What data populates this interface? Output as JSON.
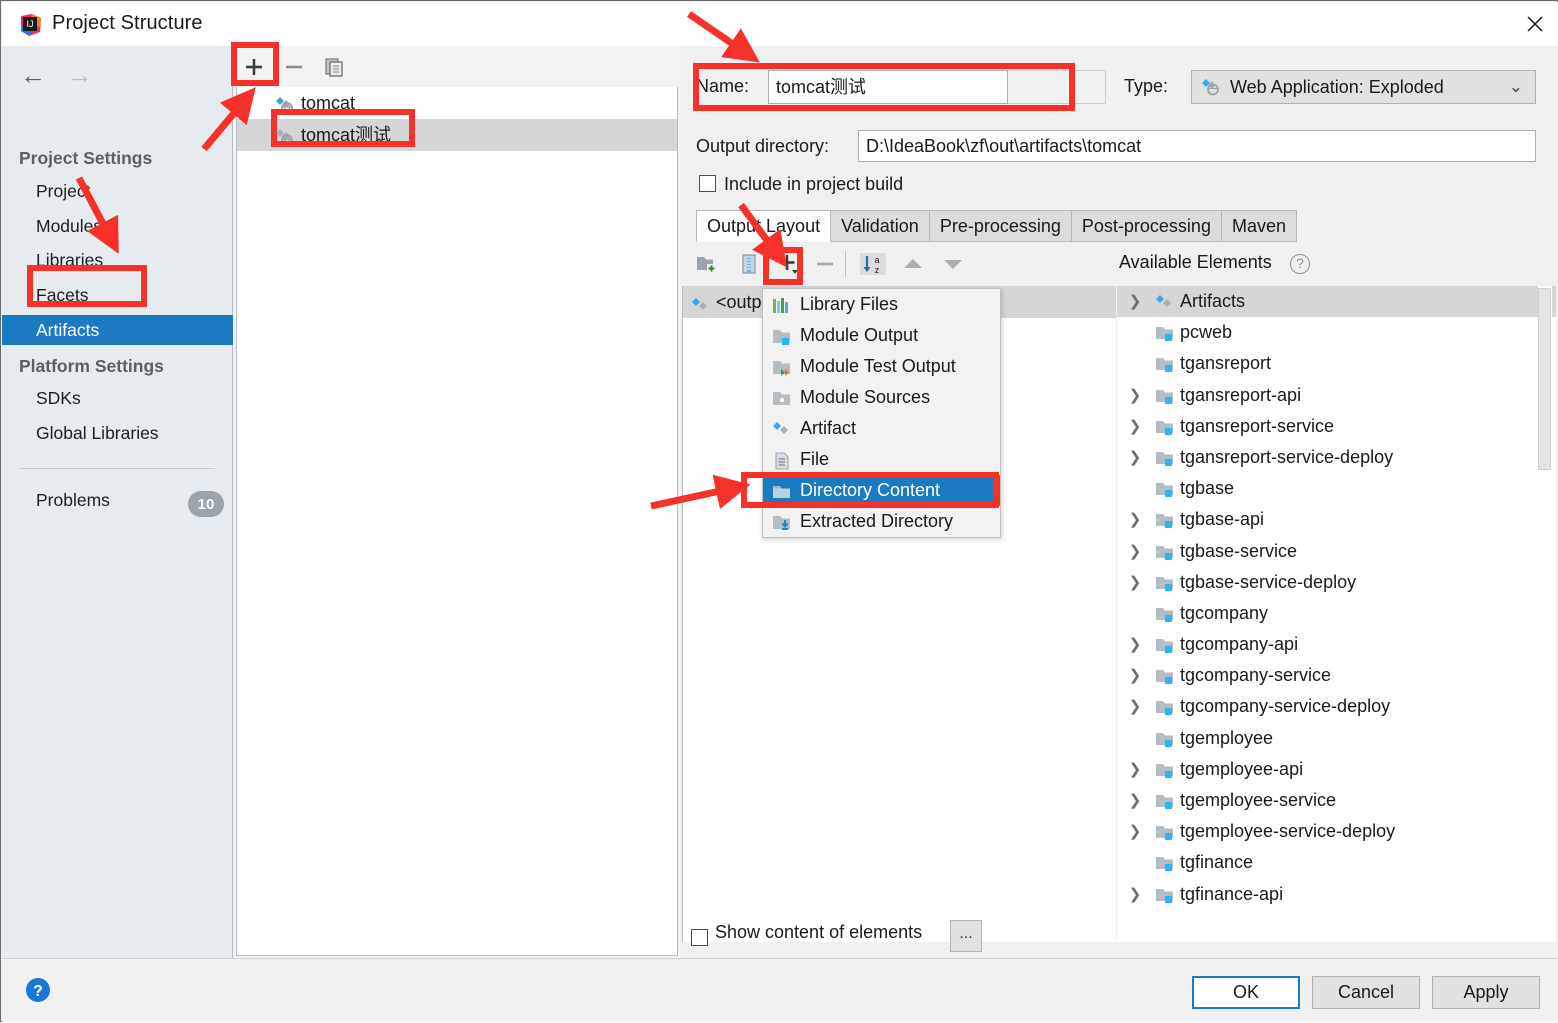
{
  "window": {
    "title": "Project Structure",
    "app_icon": "intellij-idea-icon",
    "close_icon": "close-icon"
  },
  "sidebar": {
    "back_icon": "arrow-left-icon",
    "forward_icon": "arrow-right-icon",
    "groups": [
      {
        "header": "Project Settings",
        "items": [
          {
            "label": "Project",
            "selected": false
          },
          {
            "label": "Modules",
            "selected": false
          },
          {
            "label": "Libraries",
            "selected": false
          },
          {
            "label": "Facets",
            "selected": false
          },
          {
            "label": "Artifacts",
            "selected": true
          }
        ]
      },
      {
        "header": "Platform Settings",
        "items": [
          {
            "label": "SDKs",
            "selected": false
          },
          {
            "label": "Global Libraries",
            "selected": false
          }
        ]
      }
    ],
    "problems": {
      "label": "Problems",
      "count": "10"
    },
    "selected_accent": "#1c7ac0"
  },
  "artifacts_panel": {
    "toolbar": {
      "add_label": "+",
      "remove_label": "−",
      "copy_icon": "copy-icon"
    },
    "items": [
      {
        "label": "tomcat",
        "icon": "web-application-exploded-icon",
        "selected": false
      },
      {
        "label": "tomcat测试",
        "icon": "web-application-exploded-icon",
        "selected": true
      }
    ]
  },
  "detail": {
    "name_label": "Name:",
    "name_value": "tomcat测试",
    "type_label": "Type:",
    "type_value": "Web Application: Exploded",
    "type_icon": "web-application-exploded-icon",
    "type_chevron": "chevron-down-icon",
    "output_dir_label": "Output directory:",
    "output_dir_value": "D:\\IdeaBook\\zf\\out\\artifacts\\tomcat",
    "browse_icon": "folder-open-icon",
    "include_in_build_label": "Include in project build",
    "include_in_build_checked": false,
    "tabs": [
      {
        "label": "Output Layout",
        "active": true
      },
      {
        "label": "Validation",
        "active": false
      },
      {
        "label": "Pre-processing",
        "active": false
      },
      {
        "label": "Post-processing",
        "active": false
      },
      {
        "label": "Maven",
        "active": false
      }
    ],
    "layout_toolbar": {
      "new_folder_icon": "new-folder-icon",
      "create_archive_icon": "create-archive-icon",
      "add_icon": "add-dropdown-icon",
      "remove_icon": "minus-icon",
      "sort_icon": "sort-az-icon",
      "move_up_icon": "arrow-up-icon",
      "move_down_icon": "arrow-down-icon"
    },
    "output_tree": [
      {
        "label": "<outp",
        "icon": "artifact-icon",
        "selected": true
      }
    ],
    "available_elements": {
      "header": "Available Elements",
      "help_icon": "question-mark-icon",
      "items": [
        {
          "label": "Artifacts",
          "icon": "artifact-icon",
          "expandable": true,
          "selected": true
        },
        {
          "label": "pcweb",
          "icon": "module-output-icon",
          "expandable": false,
          "selected": false
        },
        {
          "label": "tgansreport",
          "icon": "module-output-icon",
          "expandable": false,
          "selected": false
        },
        {
          "label": "tgansreport-api",
          "icon": "module-output-icon",
          "expandable": true,
          "selected": false
        },
        {
          "label": "tgansreport-service",
          "icon": "module-output-icon",
          "expandable": true,
          "selected": false
        },
        {
          "label": "tgansreport-service-deploy",
          "icon": "module-output-icon",
          "expandable": true,
          "selected": false
        },
        {
          "label": "tgbase",
          "icon": "module-output-icon",
          "expandable": false,
          "selected": false
        },
        {
          "label": "tgbase-api",
          "icon": "module-output-icon",
          "expandable": true,
          "selected": false
        },
        {
          "label": "tgbase-service",
          "icon": "module-output-icon",
          "expandable": true,
          "selected": false
        },
        {
          "label": "tgbase-service-deploy",
          "icon": "module-output-icon",
          "expandable": true,
          "selected": false
        },
        {
          "label": "tgcompany",
          "icon": "module-output-icon",
          "expandable": false,
          "selected": false
        },
        {
          "label": "tgcompany-api",
          "icon": "module-output-icon",
          "expandable": true,
          "selected": false
        },
        {
          "label": "tgcompany-service",
          "icon": "module-output-icon",
          "expandable": true,
          "selected": false
        },
        {
          "label": "tgcompany-service-deploy",
          "icon": "module-output-icon",
          "expandable": true,
          "selected": false
        },
        {
          "label": "tgemployee",
          "icon": "module-output-icon",
          "expandable": false,
          "selected": false
        },
        {
          "label": "tgemployee-api",
          "icon": "module-output-icon",
          "expandable": true,
          "selected": false
        },
        {
          "label": "tgemployee-service",
          "icon": "module-output-icon",
          "expandable": true,
          "selected": false
        },
        {
          "label": "tgemployee-service-deploy",
          "icon": "module-output-icon",
          "expandable": true,
          "selected": false
        },
        {
          "label": "tgfinance",
          "icon": "module-output-icon",
          "expandable": false,
          "selected": false
        },
        {
          "label": "tgfinance-api",
          "icon": "module-output-icon",
          "expandable": true,
          "selected": false
        }
      ]
    },
    "show_content_label": "Show content of elements",
    "show_content_checked": false,
    "ellipsis_label": "..."
  },
  "add_menu": {
    "items": [
      {
        "label": "Library Files",
        "icon": "library-files-icon",
        "selected": false
      },
      {
        "label": "Module Output",
        "icon": "module-output-icon",
        "selected": false
      },
      {
        "label": "Module Test Output",
        "icon": "module-test-output-icon",
        "selected": false
      },
      {
        "label": "Module Sources",
        "icon": "module-sources-icon",
        "selected": false
      },
      {
        "label": "Artifact",
        "icon": "artifact-icon",
        "selected": false
      },
      {
        "label": "File",
        "icon": "file-icon",
        "selected": false
      },
      {
        "label": "Directory Content",
        "icon": "directory-content-icon",
        "selected": true
      },
      {
        "label": "Extracted Directory",
        "icon": "extracted-directory-icon",
        "selected": false
      }
    ]
  },
  "footer": {
    "help_icon": "help-icon",
    "ok_label": "OK",
    "cancel_label": "Cancel",
    "apply_label": "Apply"
  },
  "annotations": {
    "color": "#f5312a",
    "boxes": [
      "artifacts-add-button",
      "artifact-tomcat-test-item",
      "sidebar-artifacts-item",
      "name-field",
      "layout-add-button",
      "directory-content-menu-item"
    ],
    "arrows": [
      "arrow-to-add-button",
      "arrow-to-artifacts",
      "arrow-to-name-field",
      "arrow-to-output-layout-add",
      "arrow-to-directory-content"
    ]
  }
}
